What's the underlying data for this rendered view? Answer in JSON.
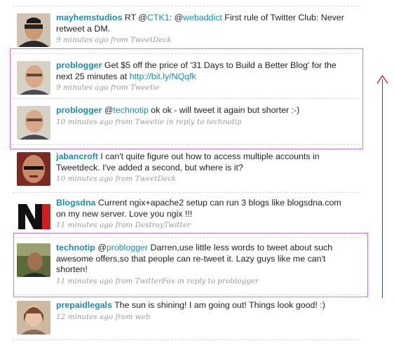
{
  "tweets": [
    {
      "user": "mayhemstudios",
      "parts": [
        "RT @",
        "CTK1",
        ": @",
        "webaddict",
        " First rule of Twitter Club: Never retweet a DM."
      ],
      "meta": "9 minutes ago from TweetDeck"
    },
    {
      "user": "problogger",
      "text": "Get $5 off the price of '31 Days to Build a Better Blog' for the next 25 minutes at ",
      "link": "http://bit.ly/NQqfk",
      "meta": "9 minutes ago from Tweetie"
    },
    {
      "user": "problogger",
      "parts": [
        "@",
        "technotip",
        " ok ok - will tweet it again but shorter :-)"
      ],
      "meta": "10 minutes ago from Tweetie in reply to technotip"
    },
    {
      "user": "jabancroft",
      "text": "I can't quite figure out how to access multiple accounts in Tweetdeck. I've added a second, but where is it?",
      "meta": "10 minutes ago from TweetDeck"
    },
    {
      "user": "Blogsdna",
      "text": "Current ngix+apache2 setup can run 3 blogs like blogsdna.com on my new server. Love you ngix !!!",
      "meta": "11 minutes ago from DestroyTwitter"
    },
    {
      "user": "technotip",
      "parts": [
        "@",
        "problogger",
        " Darren,use little less words to tweet about such awesome offers,so that people can re-tweet it. Lazy guys like me can't shorten!"
      ],
      "meta": "11 minutes ago from TwitterFox in reply to problogger"
    },
    {
      "user": "prepaidlegals",
      "text": "The sun is shining! I am going out! Things look good! :)",
      "meta": "12 minutes ago from web"
    }
  ],
  "colors": {
    "link": "#1a8ba8",
    "highlight_box": "#e26ee2",
    "arrow": "#c81212",
    "meta_text": "#9a9a9a"
  },
  "icons": [
    "up-arrow-icon"
  ]
}
